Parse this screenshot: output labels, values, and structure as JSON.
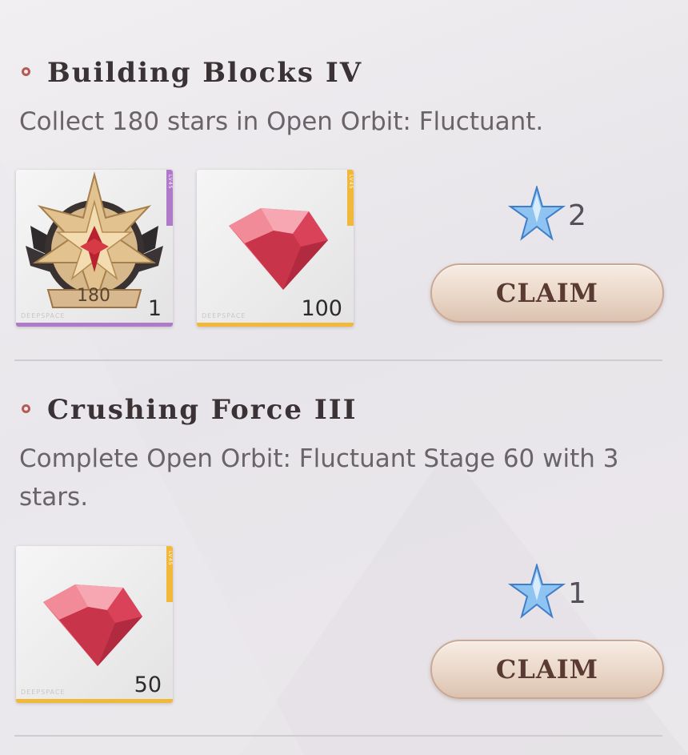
{
  "quests": [
    {
      "title": "Building Blocks IV",
      "description": "Collect 180 stars in Open Orbit: Fluctuant.",
      "rewards": [
        {
          "type": "emblem",
          "badge_label": "180",
          "count": "1",
          "brand": "DEEPSPACE",
          "side_label": "LV45",
          "rarity_color": "#b07acb"
        },
        {
          "type": "diamond",
          "count": "100",
          "brand": "DEEPSPACE",
          "side_label": "LV45",
          "rarity_color": "#f2b83a"
        }
      ],
      "points": "2",
      "points_icon": "blue-star-icon",
      "claim_label": "CLAIM"
    },
    {
      "title": "Crushing Force III",
      "description": "Complete Open Orbit: Fluctuant Stage 60 with 3 stars.",
      "rewards": [
        {
          "type": "diamond",
          "count": "50",
          "brand": "DEEPSPACE",
          "side_label": "LV45",
          "rarity_color": "#f2b83a"
        }
      ],
      "points": "1",
      "points_icon": "blue-star-icon",
      "claim_label": "CLAIM"
    }
  ],
  "colors": {
    "accent_bullet": "#b55b56",
    "title": "#3a3234",
    "description": "#6a6468",
    "claim_text": "#5a3b34",
    "star": "#7fb8ee"
  }
}
